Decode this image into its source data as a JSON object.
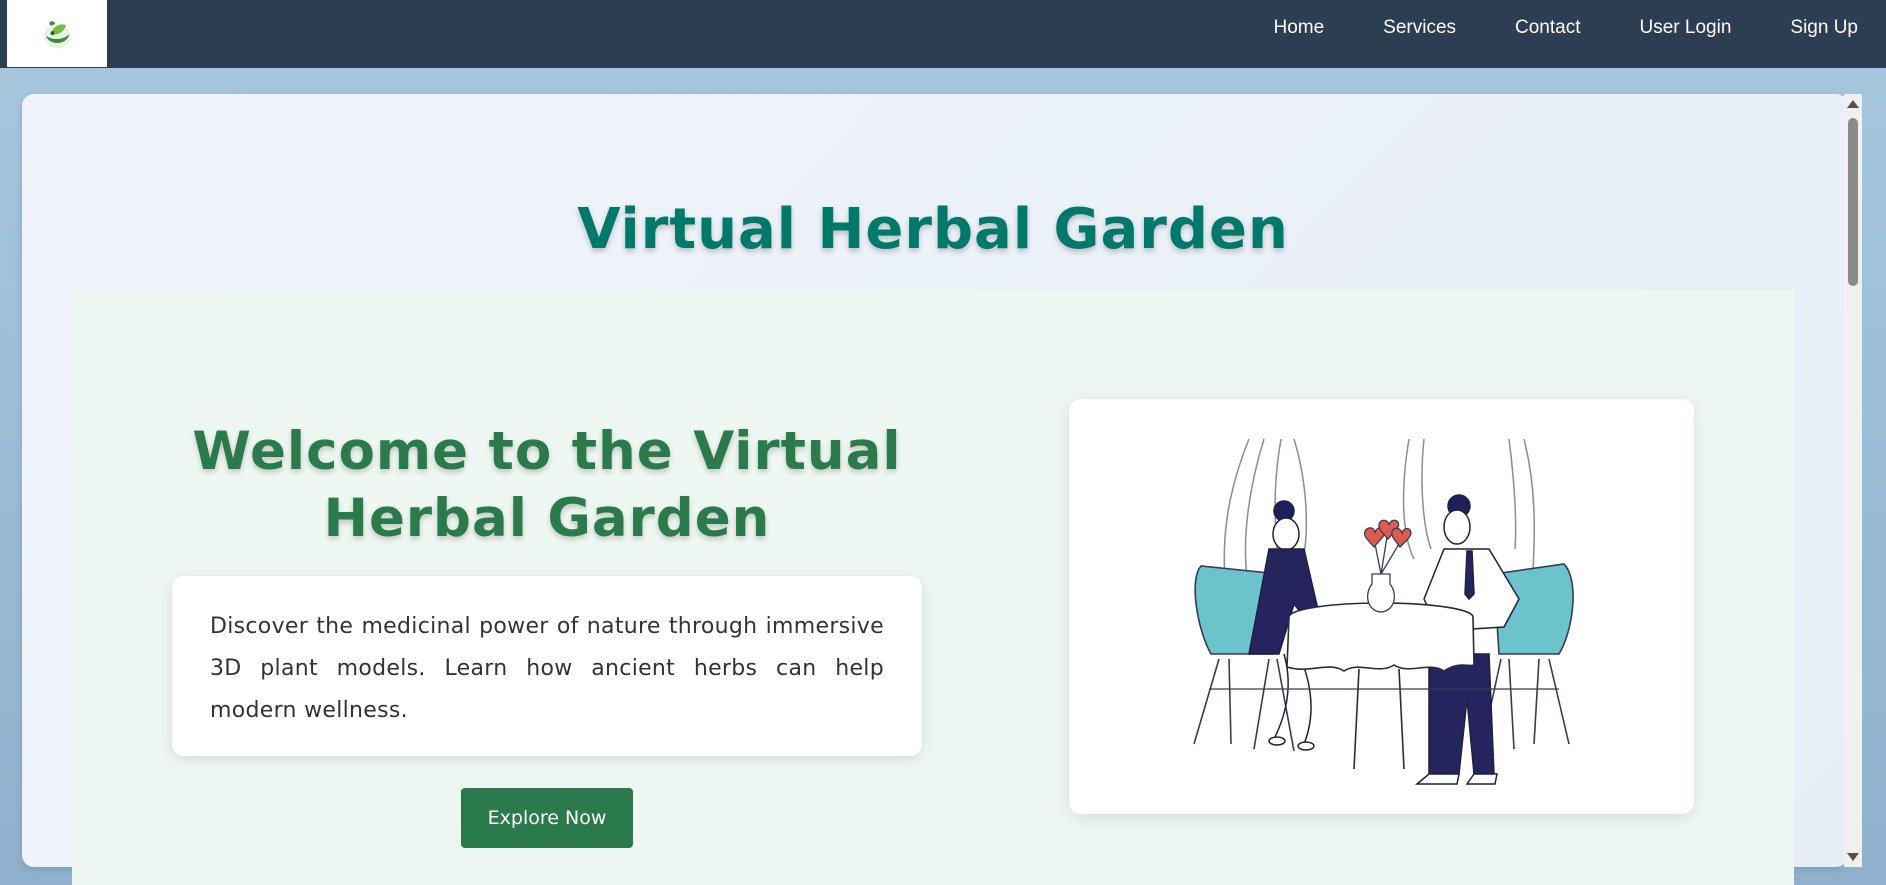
{
  "navbar": {
    "logo_icon": "herbal-leaf-logo",
    "links": [
      "Home",
      "Services",
      "Contact",
      "User Login",
      "Sign Up"
    ]
  },
  "main": {
    "title": "Virtual Herbal Garden",
    "welcome_heading_line1": "Welcome to the Virtual",
    "welcome_heading_line2": "Herbal Garden",
    "description": "Discover the medicinal power of nature through immersive 3D plant models. Learn how ancient herbs can help modern wellness.",
    "explore_label": "Explore Now",
    "illustration": "couple-dining-illustration"
  },
  "colors": {
    "navbar_bg": "#2d3d52",
    "title_color": "#00796b",
    "heading_color": "#2b7a4b",
    "button_bg": "#2b7a4b",
    "section_bg": "#eef7f1"
  }
}
